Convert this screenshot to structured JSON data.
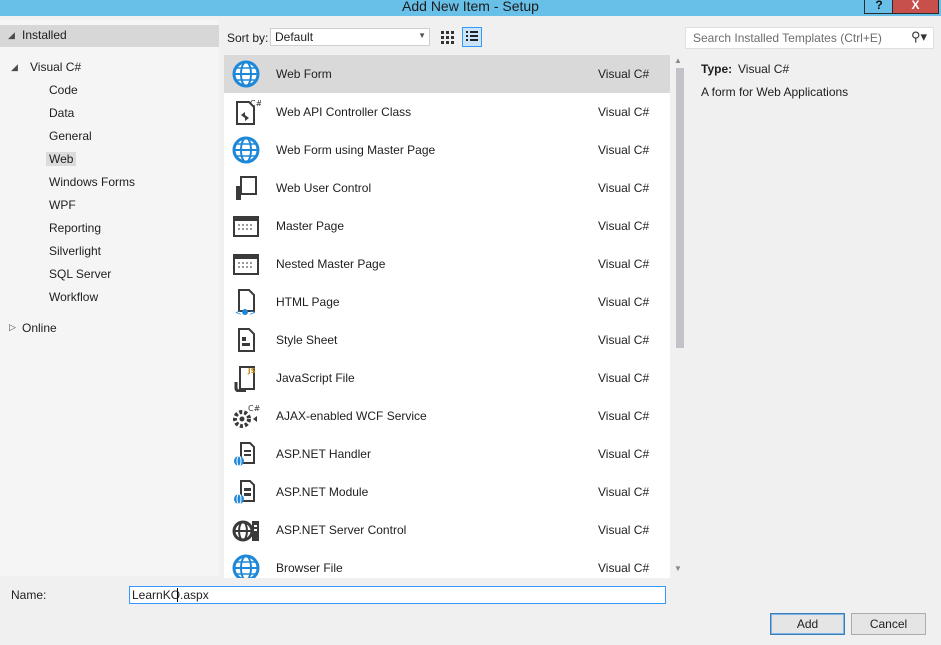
{
  "window": {
    "title": "Add New Item - Setup",
    "help_label": "?",
    "close_label": "X"
  },
  "tree": {
    "installed": "Installed",
    "visual_csharp": "Visual C#",
    "items": [
      "Code",
      "Data",
      "General",
      "Web",
      "Windows Forms",
      "WPF",
      "Reporting",
      "Silverlight",
      "SQL Server",
      "Workflow"
    ],
    "selected": "Web",
    "online": "Online"
  },
  "toolbar": {
    "sort_by_label": "Sort by:",
    "sort_value": "Default"
  },
  "search": {
    "placeholder": "Search Installed Templates (Ctrl+E)"
  },
  "templates": [
    {
      "name": "Web Form",
      "lang": "Visual C#",
      "icon": "globe-icon"
    },
    {
      "name": "Web API Controller Class",
      "lang": "Visual C#",
      "icon": "csharp-class-icon"
    },
    {
      "name": "Web Form using Master Page",
      "lang": "Visual C#",
      "icon": "globe-icon"
    },
    {
      "name": "Web User Control",
      "lang": "Visual C#",
      "icon": "user-control-icon"
    },
    {
      "name": "Master Page",
      "lang": "Visual C#",
      "icon": "master-page-icon"
    },
    {
      "name": "Nested Master Page",
      "lang": "Visual C#",
      "icon": "master-page-icon"
    },
    {
      "name": "HTML Page",
      "lang": "Visual C#",
      "icon": "html-page-icon"
    },
    {
      "name": "Style Sheet",
      "lang": "Visual C#",
      "icon": "stylesheet-icon"
    },
    {
      "name": "JavaScript File",
      "lang": "Visual C#",
      "icon": "javascript-icon"
    },
    {
      "name": "AJAX-enabled WCF Service",
      "lang": "Visual C#",
      "icon": "wcf-service-icon"
    },
    {
      "name": "ASP.NET Handler",
      "lang": "Visual C#",
      "icon": "handler-icon"
    },
    {
      "name": "ASP.NET Module",
      "lang": "Visual C#",
      "icon": "module-icon"
    },
    {
      "name": "ASP.NET Server Control",
      "lang": "Visual C#",
      "icon": "server-control-icon"
    },
    {
      "name": "Browser File",
      "lang": "Visual C#",
      "icon": "globe-icon"
    }
  ],
  "details": {
    "type_label": "Type:",
    "type_value": "Visual C#",
    "description": "A form for Web Applications"
  },
  "name_field": {
    "label": "Name:",
    "value": "LearnKO.aspx"
  },
  "buttons": {
    "add": "Add",
    "cancel": "Cancel"
  },
  "colors": {
    "titlebar": "#68bfe8",
    "close": "#c7504b",
    "accent": "#3399ff",
    "selected_row": "#d9d9d9"
  }
}
